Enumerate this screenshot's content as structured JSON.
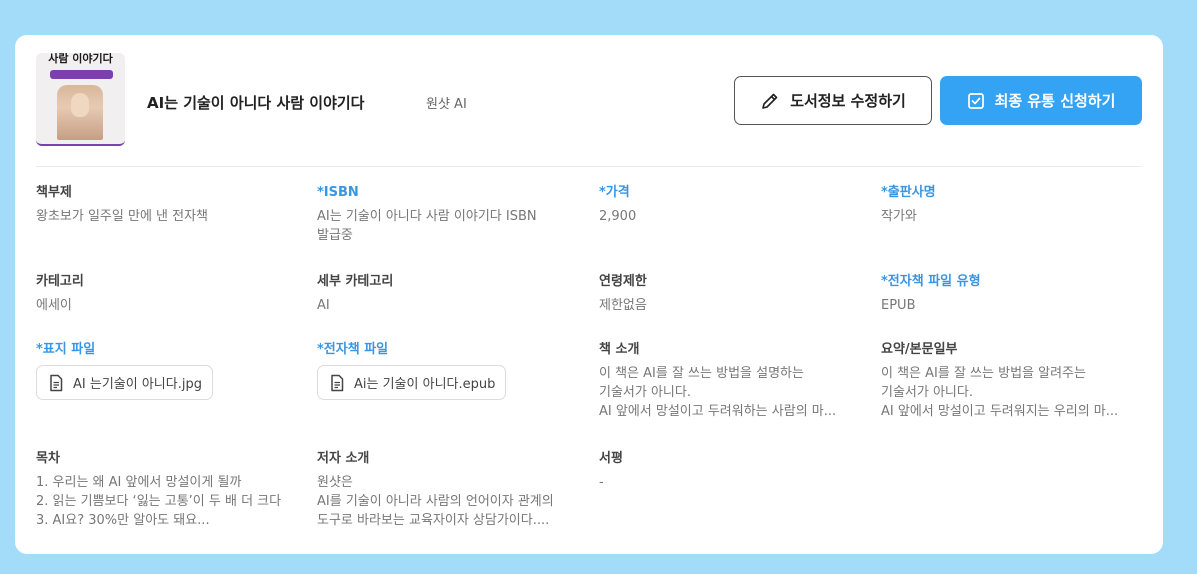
{
  "book": {
    "cover_title": "사람 이야기다",
    "title": "AI는 기술이 아니다 사람 이야기다",
    "author": "원샷 AI"
  },
  "actions": {
    "edit_label": "도서정보 수정하기",
    "edit_icon": "pencil-icon",
    "submit_label": "최종 유통 신청하기",
    "submit_icon": "checkbox-icon"
  },
  "fields": {
    "subtitle": {
      "label": "책부제",
      "value": "왕초보가 일주일 만에 낸 전자책"
    },
    "isbn": {
      "label": "*ISBN",
      "value": "AI는 기술이 아니다 사람 이야기다 ISBN 발급중"
    },
    "price": {
      "label": "*가격",
      "value": "2,900"
    },
    "publisher": {
      "label": "*출판사명",
      "value": "작가와"
    },
    "category": {
      "label": "카테고리",
      "value": "에세이"
    },
    "subcategory": {
      "label": "세부 카테고리",
      "value": "AI"
    },
    "age_limit": {
      "label": "연령제한",
      "value": "제한없음"
    },
    "ebook_type": {
      "label": "*전자책 파일 유형",
      "value": "EPUB"
    },
    "cover_file": {
      "label": "*표지 파일",
      "file": "AI 는기술이 아니다.jpg",
      "icon": "file-icon"
    },
    "ebook_file": {
      "label": "*전자책 파일",
      "file": "Ai는 기술이 아니다.epub",
      "icon": "file-icon"
    },
    "introduction": {
      "label": "책 소개",
      "lines": [
        "이 책은 AI를 잘 쓰는 방법을 설명하는 기술서가 아니다.",
        "AI 앞에서 망설이고 두려워하는 사람의 마..."
      ]
    },
    "summary": {
      "label": "요약/본문일부",
      "lines": [
        "이 책은 AI를 잘 쓰는 방법을 알려주는 기술서가 아니다.",
        "AI 앞에서 망설이고 두려워지는 우리의 마..."
      ]
    },
    "toc": {
      "label": "목차",
      "lines": [
        "1. 우리는 왜 AI 앞에서 망설이게 될까",
        "2. 읽는 기쁨보다 ‘잃는 고통’이 두 배 더 크다",
        "3. AI요? 30%만 알아도 돼요..."
      ]
    },
    "author_intro": {
      "label": "저자 소개",
      "lines": [
        "원샷은",
        "AI를 기술이 아니라 사람의 언어이자 관계의 도구로 바라보는 교육자이자 상담가이다...."
      ]
    },
    "review": {
      "label": "서평",
      "value": "-"
    }
  }
}
